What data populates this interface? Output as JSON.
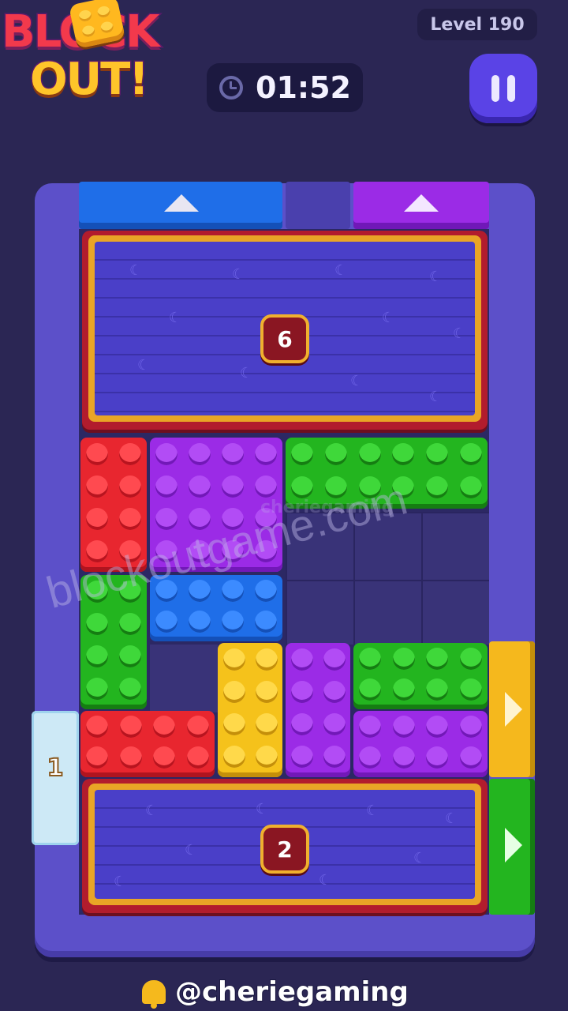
{
  "header": {
    "logo_line1": "BLOCK",
    "logo_line2": "OUT!",
    "level_label": "Level 190",
    "timer": "01:52"
  },
  "board": {
    "top_box_count": "6",
    "bottom_box_count": "2",
    "ice_count": "1"
  },
  "watermark": {
    "main": "blockoutgame.com",
    "faint": "cheriegaming"
  },
  "footer": {
    "handle": "@cheriegaming"
  },
  "colors": {
    "red": "#e8262f",
    "purple": "#9b2be6",
    "green": "#23b51f",
    "blue": "#1f6ee8",
    "yellow": "#f5c21b",
    "board": "#5c50c9",
    "box_red": "#b21c2d",
    "box_gold": "#e9a526"
  },
  "icons": [
    "clock-icon",
    "pause-icon",
    "up-arrow-icon",
    "right-arrow-icon",
    "bell-icon"
  ]
}
